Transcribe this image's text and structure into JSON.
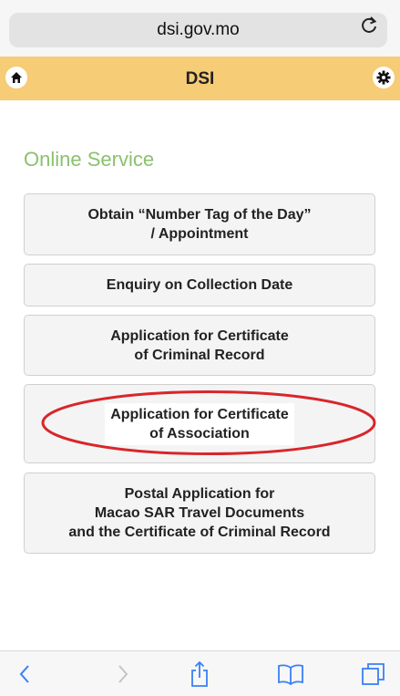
{
  "browser": {
    "url": "dsi.gov.mo"
  },
  "header": {
    "title": "DSI"
  },
  "main": {
    "section_title": "Online Service",
    "services": [
      {
        "lines": [
          "Obtain “Number Tag of the Day”",
          "/ Appointment"
        ]
      },
      {
        "lines": [
          "Enquiry on Collection Date"
        ]
      },
      {
        "lines": [
          "Application for Certificate",
          "of Criminal Record"
        ]
      },
      {
        "lines": [
          "Application for Certificate",
          "of Association"
        ],
        "highlighted": true
      },
      {
        "lines": [
          "Postal Application for",
          "Macao SAR Travel Documents",
          "and the Certificate of Criminal Record"
        ]
      }
    ]
  },
  "colors": {
    "header_bg": "#f6cc77",
    "section_title": "#8ac16e",
    "annotation": "#d8262b",
    "toolbar_icon": "#3b7ff6"
  },
  "icons": {
    "reload": "reload-icon",
    "home": "home-icon",
    "settings": "gear-icon",
    "back": "chevron-left-icon",
    "forward": "chevron-right-icon",
    "share": "share-icon",
    "bookmarks": "book-icon",
    "tabs": "tabs-icon"
  }
}
